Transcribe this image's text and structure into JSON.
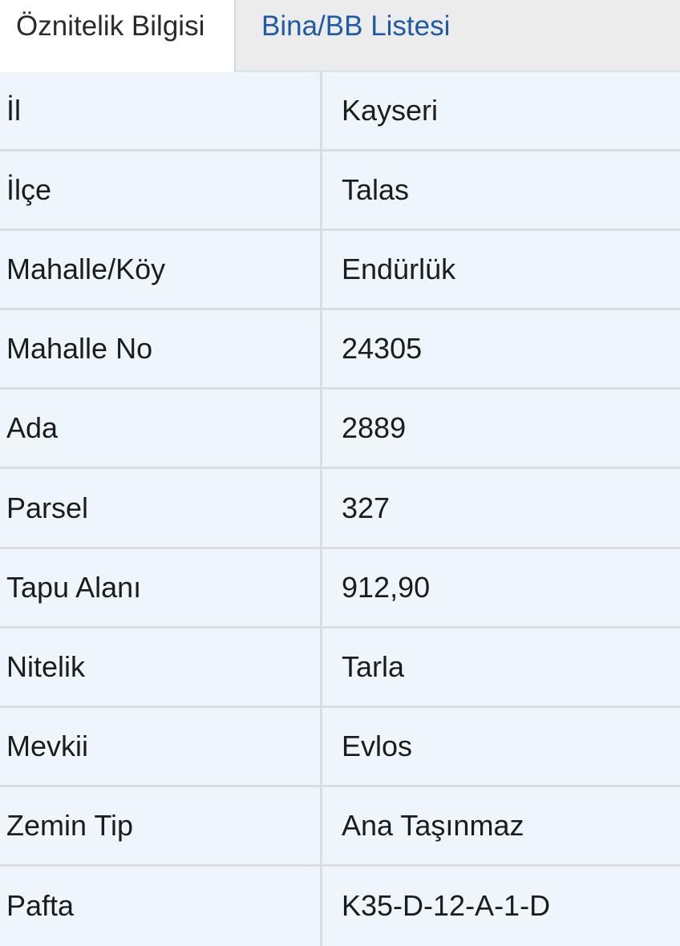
{
  "tabs": {
    "active_label": "Öznitelik Bilgisi",
    "inactive_label": "Bina/BB Listesi",
    "active_color": "#2b2b2b",
    "link_color": "#1e5aa8"
  },
  "attributes": [
    {
      "key": "İl",
      "value": "Kayseri"
    },
    {
      "key": "İlçe",
      "value": "Talas"
    },
    {
      "key": "Mahalle/Köy",
      "value": "Endürlük"
    },
    {
      "key": "Mahalle No",
      "value": "24305"
    },
    {
      "key": "Ada",
      "value": "2889"
    },
    {
      "key": "Parsel",
      "value": "327"
    },
    {
      "key": "Tapu Alanı",
      "value": "912,90"
    },
    {
      "key": "Nitelik",
      "value": "Tarla"
    },
    {
      "key": "Mevkii",
      "value": "Evlos"
    },
    {
      "key": "Zemin Tip",
      "value": "Ana Taşınmaz"
    },
    {
      "key": "Pafta",
      "value": "K35-D-12-A-1-D"
    }
  ]
}
